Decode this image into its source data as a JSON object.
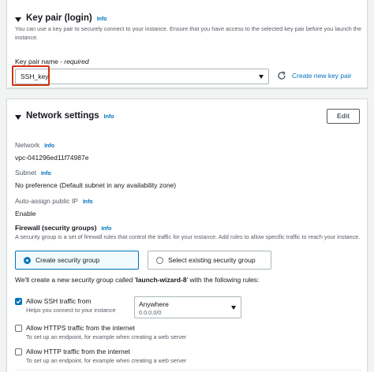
{
  "key_pair_section": {
    "title": "Key pair (login)",
    "info": "Info",
    "description": "You can use a key pair to securely connect to your instance. Ensure that you have access to the selected key pair before you launch the instance.",
    "field_label": "Key pair name",
    "field_required": " - required",
    "selected_key": "SSH_key",
    "create_link": "Create new key pair",
    "refresh_icon": "refresh-icon"
  },
  "network_section": {
    "title": "Network settings",
    "info": "Info",
    "edit_button": "Edit",
    "network_label": "Network",
    "network_info": "Info",
    "network_value": "vpc-041296ed11f74987e",
    "subnet_label": "Subnet",
    "subnet_info": "Info",
    "subnet_value": "No preference (Default subnet in any availability zone)",
    "public_ip_label": "Auto-assign public IP",
    "public_ip_info": "Info",
    "public_ip_value": "Enable",
    "firewall_label": "Firewall (security groups)",
    "firewall_info": "Info",
    "firewall_desc": "A security group is a set of firewall rules that control the traffic for your instance. Add rules to allow specific traffic to reach your instance.",
    "option_create": "Create security group",
    "option_existing": "Select existing security group",
    "selected_option": "create",
    "rule_note_prefix": "We'll create a new security group called '",
    "rule_note_name": "launch-wizard-8",
    "rule_note_suffix": "' with the following rules:",
    "rules": [
      {
        "label": "Allow SSH traffic from",
        "desc": "Helps you connect to your instance",
        "checked": true,
        "source_title": "Anywhere",
        "source_value": "0.0.0.0/0"
      },
      {
        "label": "Allow HTTPS traffic from the internet",
        "desc": "To set up an endpoint, for example when creating a web server",
        "checked": false
      },
      {
        "label": "Allow HTTP traffic from the internet",
        "desc": "To set up an endpoint, for example when creating a web server",
        "checked": false
      }
    ]
  },
  "colors": {
    "accent": "#0073bb",
    "highlight": "#d13212",
    "text": "#16191f",
    "muted": "#545b64",
    "background": "#f2f3f3"
  }
}
